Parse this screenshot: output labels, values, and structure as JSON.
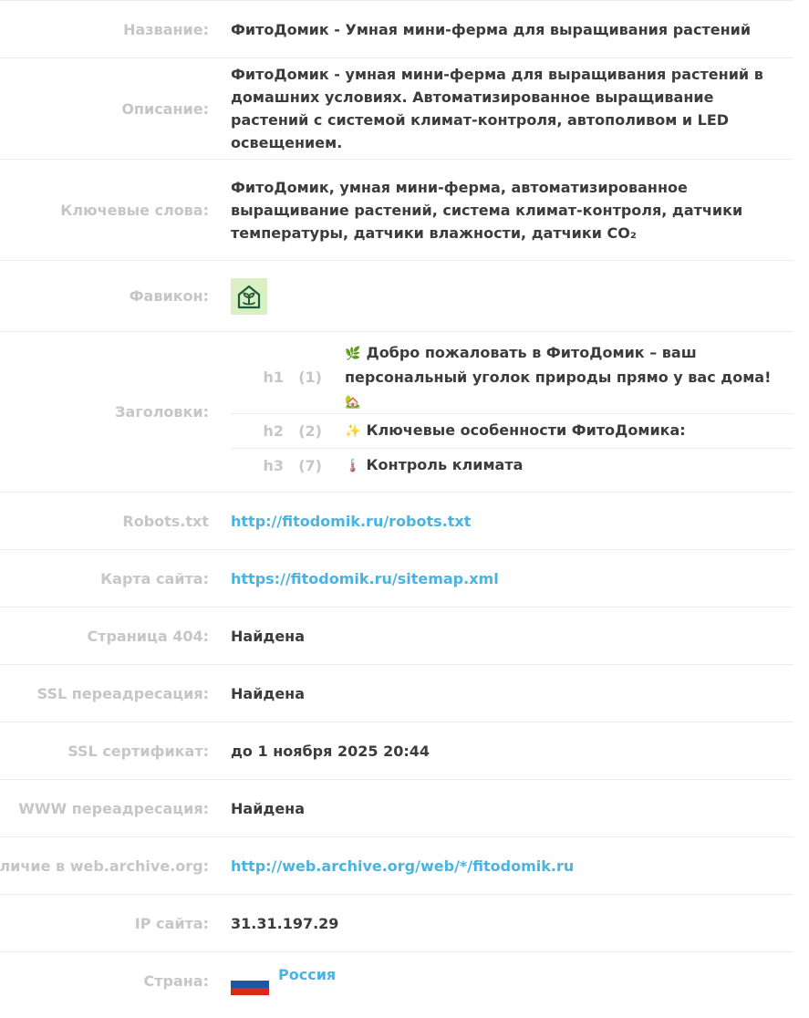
{
  "rows": {
    "name": {
      "label": "Название:",
      "value": "ФитоДомик - Умная мини-ферма для выращивания растений"
    },
    "description": {
      "label": "Описание:",
      "value": "ФитоДомик - умная мини-ферма для выращивания растений в домашних условиях. Автоматизированное выращивание растений с системой климат-контроля, автополивом и LED освещением."
    },
    "keywords": {
      "label": "Ключевые слова:",
      "value": "ФитоДомик, умная мини-ферма, автоматизированное выращивание растений, система климат-контроля, датчики температуры, датчики влажности, датчики CO₂"
    },
    "favicon": {
      "label": "Фавикон:",
      "icon": "house-sprout-icon"
    },
    "headings": {
      "label": "Заголовки:",
      "items": [
        {
          "tag": "h1",
          "count": "(1)",
          "emoji": "🌿",
          "text": "Добро пожаловать в ФитоДомик – ваш персональный уголок природы прямо у вас дома!",
          "emoji_after": "🏡"
        },
        {
          "tag": "h2",
          "count": "(2)",
          "emoji": "✨",
          "text": "Ключевые особенности ФитоДомика:"
        },
        {
          "tag": "h3",
          "count": "(7)",
          "emoji": "🌡️",
          "text": "Контроль климата"
        }
      ]
    },
    "robots": {
      "label": "Robots.txt",
      "value": "http://fitodomik.ru/robots.txt"
    },
    "sitemap": {
      "label": "Карта сайта:",
      "value": "https://fitodomik.ru/sitemap.xml"
    },
    "page404": {
      "label": "Страница 404:",
      "value": "Найдена"
    },
    "ssl_redirect": {
      "label": "SSL переадресация:",
      "value": "Найдена"
    },
    "ssl_cert": {
      "label": "SSL сертификат:",
      "value": "до 1 ноября 2025 20:44"
    },
    "www_redirect": {
      "label": "WWW переадресация:",
      "value": "Найдена"
    },
    "webarchive": {
      "label": "Наличие в web.archive.org:",
      "value": "http://web.archive.org/web/*/fitodomik.ru"
    },
    "ip": {
      "label": "IP сайта:",
      "value": "31.31.197.29"
    },
    "country": {
      "label": "Страна:",
      "value": "Россия",
      "flag_colors": [
        "#ffffff",
        "#1c57a5",
        "#d52b1e"
      ]
    }
  },
  "colors": {
    "label": "#c6c6c6",
    "text": "#3c3c3c",
    "link": "#4bb3e0",
    "favicon_bg": "#d9efc4",
    "favicon_fg": "#1f5b3a",
    "divider": "#ececec"
  }
}
